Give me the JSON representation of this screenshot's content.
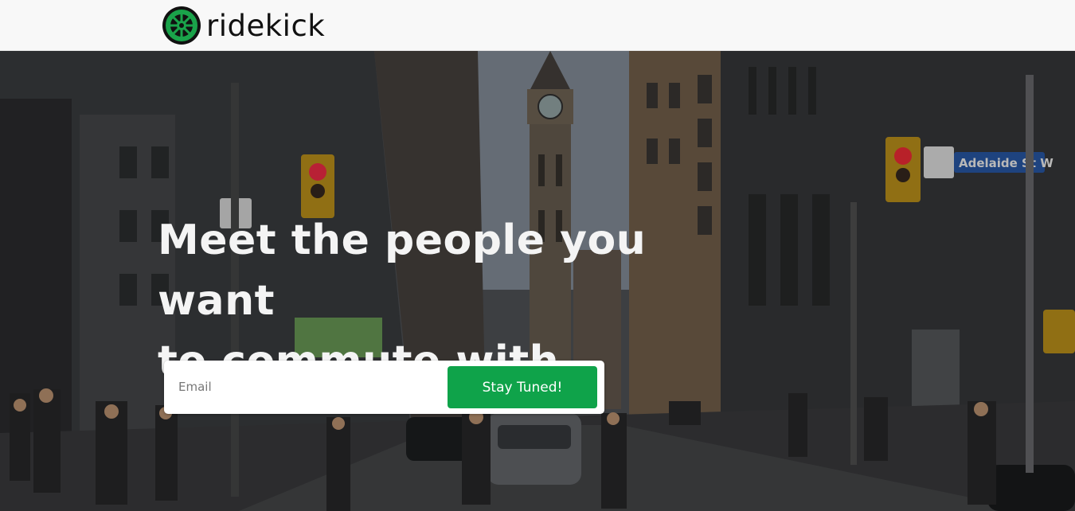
{
  "brand": {
    "name": "ridekick",
    "logo": "wheel-logo-icon",
    "accent_color": "#0fa34a"
  },
  "hero": {
    "headline_line1": "Meet the people you want",
    "headline_line2": "to commute with.",
    "background": "city-street-photo",
    "street_sign": "Adelaide St W"
  },
  "signup": {
    "email_placeholder": "Email",
    "email_value": "",
    "button_label": "Stay Tuned!",
    "button_color": "#0fa34a"
  }
}
